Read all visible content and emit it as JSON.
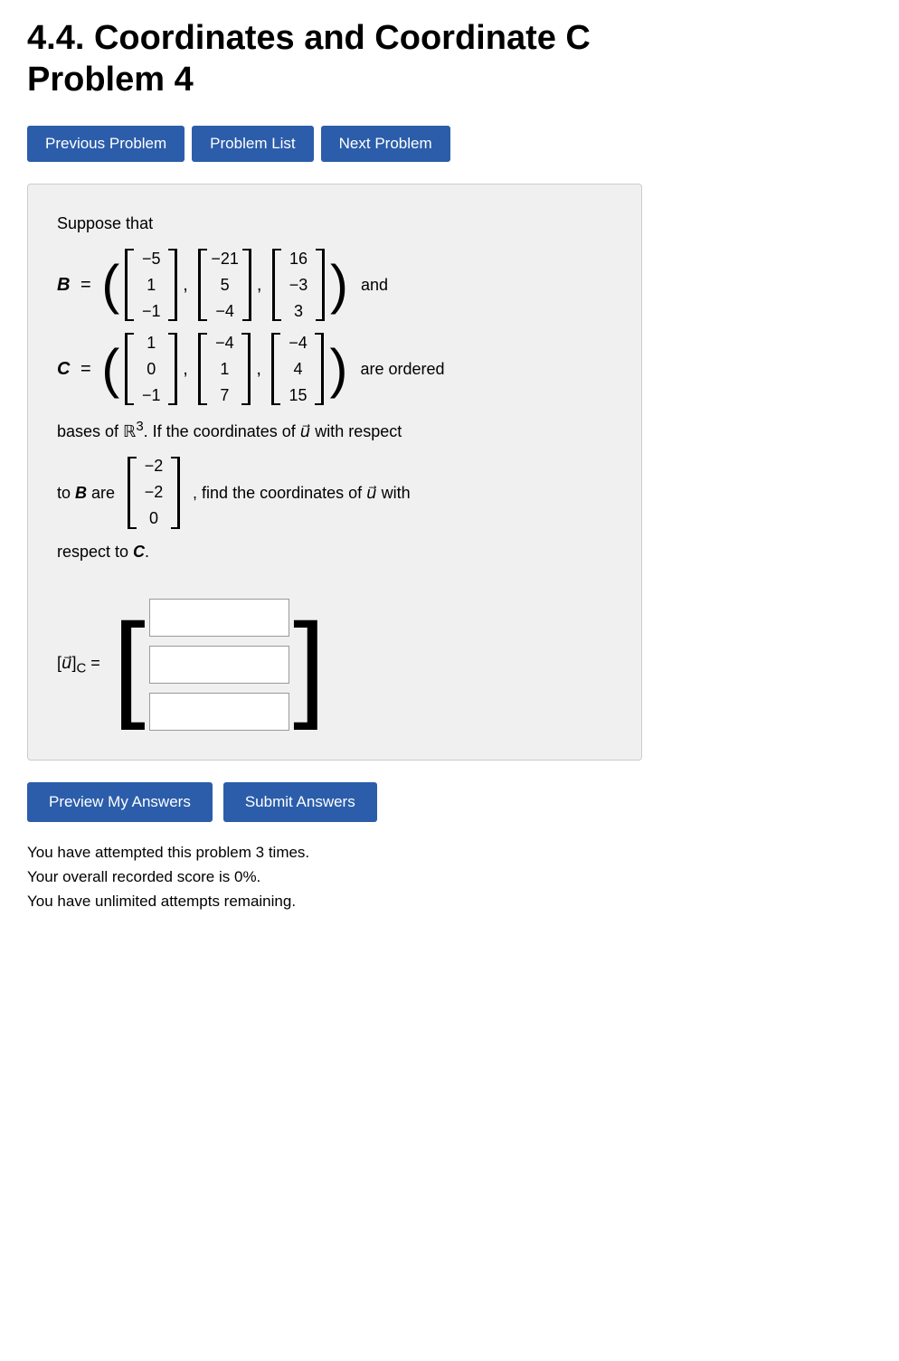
{
  "page": {
    "title_line1": "4.4. Coordinates and Coordinate C",
    "title_line2": "Problem 4"
  },
  "nav": {
    "prev_label": "Previous Problem",
    "list_label": "Problem List",
    "next_label": "Next Problem"
  },
  "problem": {
    "intro": "Suppose that",
    "B_label": "B",
    "C_label": "C",
    "equals": "=",
    "and_text": "and",
    "are_ordered": "are ordered",
    "bases_text": "bases of ℝ³. If the coordinates of",
    "u_vec": "u⃗",
    "with_respect_to": "with respect",
    "to_B": "to B are",
    "find_coords": ", find the coordinates of",
    "with_respect_C": "with respect to",
    "C_end": "C.",
    "B_matrix": {
      "col1": [
        "-5",
        "1",
        "-1"
      ],
      "col2": [
        "-21",
        "5",
        "-4"
      ],
      "col3": [
        "16",
        "-3",
        "3"
      ]
    },
    "C_matrix": {
      "col1": [
        "1",
        "0",
        "-1"
      ],
      "col2": [
        "-4",
        "1",
        "7"
      ],
      "col3": [
        "-4",
        "4",
        "15"
      ]
    },
    "coords_B": [
      "-2",
      "-2",
      "0"
    ],
    "answer_label": "[u⃗]_C =",
    "inputs": [
      "",
      "",
      ""
    ]
  },
  "bottom": {
    "preview_label": "Preview My Answers",
    "submit_label": "Submit Answers",
    "attempts_text": "You have attempted this problem 3 times.",
    "score_text": "Your overall recorded score is 0%.",
    "remaining_text": "You have unlimited attempts remaining."
  }
}
